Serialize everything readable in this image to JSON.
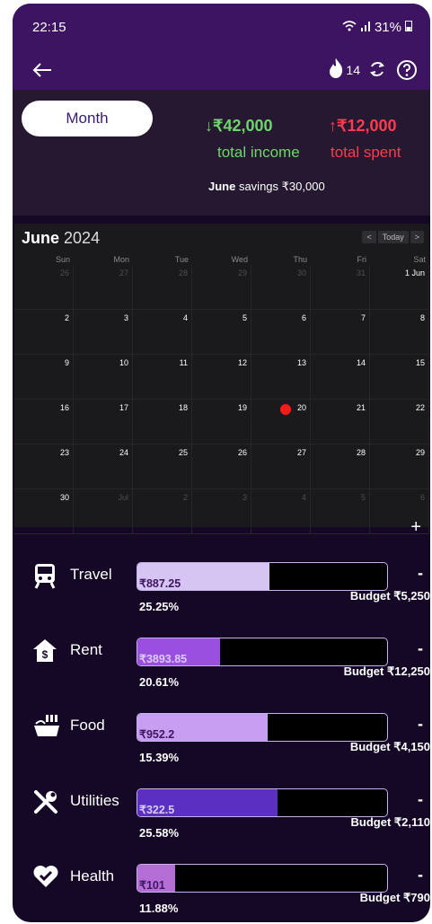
{
  "status": {
    "time": "22:15",
    "battery": "31%"
  },
  "toolbar": {
    "streak": "14"
  },
  "summary": {
    "period": "Month",
    "income_amount": "↓₹42,000",
    "income_label": "total income",
    "spent_amount": "↑₹12,000",
    "spent_label": "total spent",
    "savings_month": "June",
    "savings_text": " savings ₹30,000"
  },
  "calendar": {
    "month": "June",
    "year": "2024",
    "nav_prev": "<",
    "nav_today": "Today",
    "nav_next": ">",
    "weekdays": [
      "Sun",
      "Mon",
      "Tue",
      "Wed",
      "Thu",
      "Fri",
      "Sat"
    ],
    "weeks": [
      [
        "26",
        "27",
        "28",
        "29",
        "30",
        "31",
        "1 Jun"
      ],
      [
        "2",
        "3",
        "4",
        "5",
        "6",
        "7",
        "8"
      ],
      [
        "9",
        "10",
        "11",
        "12",
        "13",
        "14",
        "15"
      ],
      [
        "16",
        "17",
        "18",
        "19",
        "20",
        "21",
        "22"
      ],
      [
        "23",
        "24",
        "25",
        "26",
        "27",
        "28",
        "29"
      ],
      [
        "30",
        "Jul",
        "2",
        "3",
        "4",
        "5",
        "6"
      ]
    ],
    "today": "20"
  },
  "add_label": "+",
  "categories": [
    {
      "name": "Travel",
      "icon": "train-icon",
      "spent": "₹887.25",
      "percent": "25.25%",
      "budget": "Budget ₹5,250",
      "fill": 0.53,
      "color": "#d6c4f2"
    },
    {
      "name": "Rent",
      "icon": "house-dollar-icon",
      "spent": "₹3893.85",
      "percent": "20.61%",
      "budget": "Budget ₹12,250",
      "fill": 0.33,
      "color": "#9b4fe0"
    },
    {
      "name": "Food",
      "icon": "food-icon",
      "spent": "₹952.2",
      "percent": "15.39%",
      "budget": "Budget ₹4,150",
      "fill": 0.52,
      "color": "#c79ef2"
    },
    {
      "name": "Utilities",
      "icon": "tools-icon",
      "spent": "₹322.5",
      "percent": "25.58%",
      "budget": "Budget ₹2,110",
      "fill": 0.56,
      "color": "#5a2fc2"
    },
    {
      "name": "Health",
      "icon": "heart-icon",
      "spent": "₹101",
      "percent": "11.88%",
      "budget": "Budget ₹790",
      "fill": 0.15,
      "color": "#b46ed6"
    }
  ],
  "minus_label": "-"
}
